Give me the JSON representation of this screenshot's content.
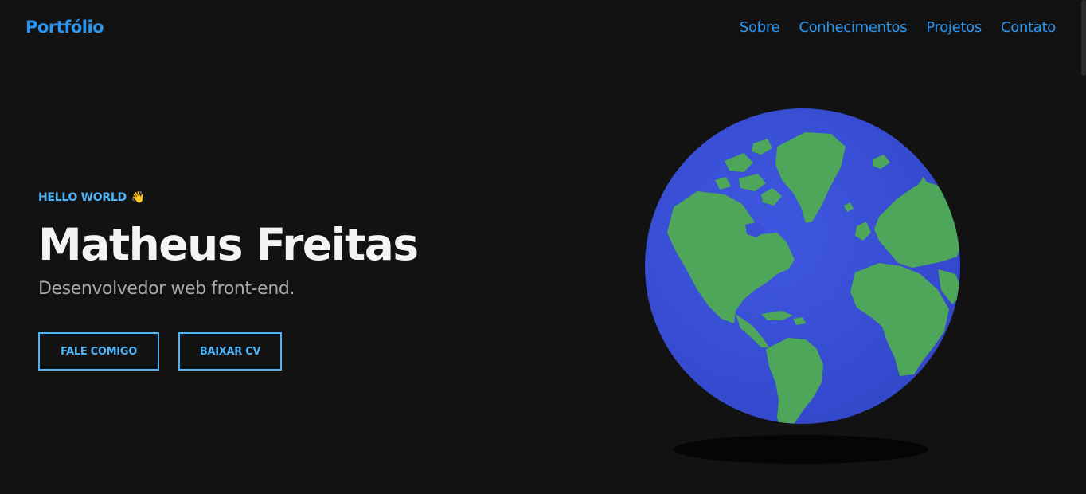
{
  "header": {
    "logo": "Portfólio",
    "nav": [
      "Sobre",
      "Conhecimentos",
      "Projetos",
      "Contato"
    ]
  },
  "hero": {
    "greeting": "HELLO WORLD",
    "greeting_emoji": "👋",
    "name": "Matheus Freitas",
    "subtitle": "Desenvolvedor web front-end.",
    "buttons": {
      "contact": "FALE COMIGO",
      "cv": "BAIXAR CV"
    }
  },
  "colors": {
    "background": "#121212",
    "accent": "#2a95f0",
    "accent_light": "#4fb3f5",
    "ocean": "#3a4fd6",
    "land": "#4ea65a"
  },
  "icons": {
    "greeting": "waving-hand-icon",
    "globe": "earth-globe-illustration"
  }
}
